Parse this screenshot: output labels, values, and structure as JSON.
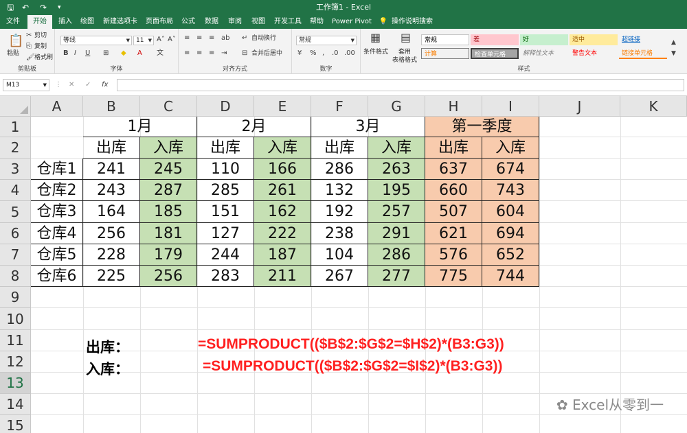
{
  "window": {
    "title": "工作簿1 - Excel",
    "quick_access": {
      "save_icon": "save-icon",
      "undo_icon": "undo-icon",
      "redo_icon": "redo-icon",
      "customize_icon": "customize-icon"
    }
  },
  "tabs": [
    {
      "label": "文件"
    },
    {
      "label": "开始"
    },
    {
      "label": "插入"
    },
    {
      "label": "绘图"
    },
    {
      "label": "新建选项卡"
    },
    {
      "label": "页面布局"
    },
    {
      "label": "公式"
    },
    {
      "label": "数据"
    },
    {
      "label": "审阅"
    },
    {
      "label": "视图"
    },
    {
      "label": "开发工具"
    },
    {
      "label": "帮助"
    },
    {
      "label": "Power Pivot"
    },
    {
      "label": "操作说明搜索"
    }
  ],
  "ribbon": {
    "clipboard": {
      "paste": "粘贴",
      "cut": "剪切",
      "copy": "复制",
      "format_painter": "格式刷",
      "label": "剪贴板"
    },
    "font": {
      "name": "等线",
      "size": "11",
      "label": "字体"
    },
    "alignment": {
      "wrap": "自动换行",
      "merge": "合并后居中",
      "label": "对齐方式"
    },
    "number": {
      "format": "常规",
      "label": "数字"
    },
    "styles": {
      "cond_format": "条件格式",
      "table_format": "套用\n表格格式",
      "cells": [
        {
          "text": "常规"
        },
        {
          "text": "差"
        },
        {
          "text": "好"
        },
        {
          "text": "适中"
        },
        {
          "text": "超链接"
        },
        {
          "text": "计算"
        },
        {
          "text": "检查单元格"
        },
        {
          "text": "解释性文本"
        },
        {
          "text": "警告文本"
        },
        {
          "text": "链接单元格"
        }
      ],
      "label": "样式"
    }
  },
  "formula_bar": {
    "name_box": "M13",
    "fx": "fx"
  },
  "columns": [
    "A",
    "B",
    "C",
    "D",
    "E",
    "F",
    "G",
    "H",
    "I",
    "J",
    "K"
  ],
  "rows": [
    "1",
    "2",
    "3",
    "4",
    "5",
    "6",
    "7",
    "8",
    "9",
    "10",
    "11",
    "12",
    "13",
    "14",
    "15"
  ],
  "selected_row": "13",
  "table": {
    "months": [
      "1月",
      "2月",
      "3月",
      "第一季度"
    ],
    "sub_headers": [
      "出库",
      "入库",
      "出库",
      "入库",
      "出库",
      "入库",
      "出库",
      "入库"
    ],
    "warehouses": [
      "仓库1",
      "仓库2",
      "仓库3",
      "仓库4",
      "仓库5",
      "仓库6"
    ],
    "values": [
      [
        241,
        245,
        110,
        166,
        286,
        263,
        637,
        674
      ],
      [
        243,
        287,
        285,
        261,
        132,
        195,
        660,
        743
      ],
      [
        164,
        185,
        151,
        162,
        192,
        257,
        507,
        604
      ],
      [
        256,
        181,
        127,
        222,
        238,
        291,
        621,
        694
      ],
      [
        228,
        179,
        244,
        187,
        104,
        286,
        576,
        652
      ],
      [
        225,
        256,
        283,
        211,
        267,
        277,
        775,
        744
      ]
    ]
  },
  "notes": [
    {
      "label": "出库：",
      "formula": "=SUMPRODUCT(($B$2:$G$2=$H$2)*(B3:G3))"
    },
    {
      "label": "入库：",
      "formula": "=SUMPRODUCT(($B$2:$G$2=$I$2)*(B3:G3))"
    }
  ],
  "watermark": "Excel从零到一",
  "colors": {
    "excel_green": "#217346",
    "in_green": "#c6e0b4",
    "quarter_orange": "#f8cbad",
    "formula_red": "#ff2020"
  }
}
